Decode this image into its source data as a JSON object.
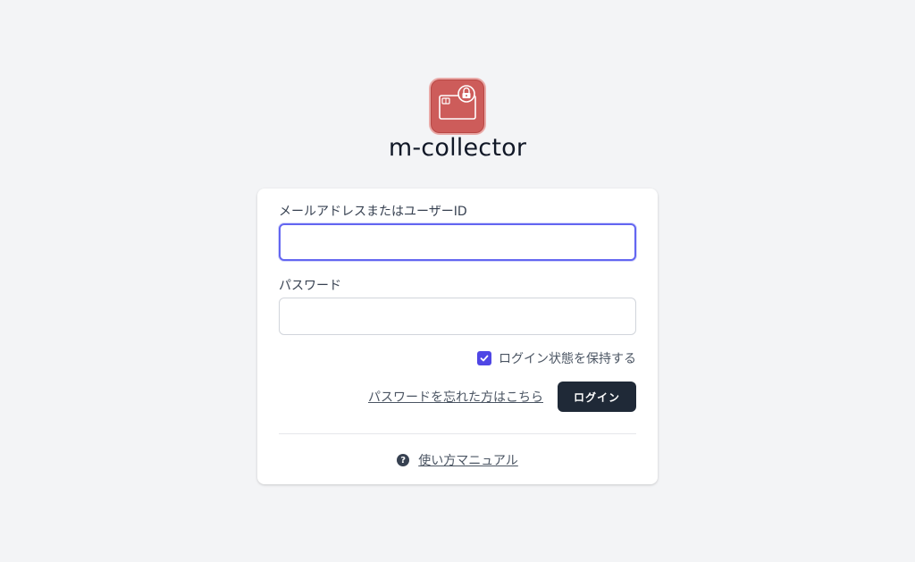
{
  "app": {
    "name": "m-collector",
    "logo_icon": "card-lock-icon",
    "logo_color": "#cd5c5a"
  },
  "form": {
    "email_label": "メールアドレスまたはユーザーID",
    "email_value": "",
    "password_label": "パスワード",
    "password_value": "",
    "remember_label": "ログイン状態を保持する",
    "remember_checked": true,
    "forgot_link": "パスワードを忘れた方はこちら",
    "login_button": "ログイン"
  },
  "footer": {
    "help_icon": "question-circle-icon",
    "manual_link": "使い方マニュアル"
  },
  "colors": {
    "accent": "#4f46e5",
    "focus_ring": "#6366f1",
    "button_bg": "#1f2937",
    "page_bg": "#f3f4f6"
  }
}
